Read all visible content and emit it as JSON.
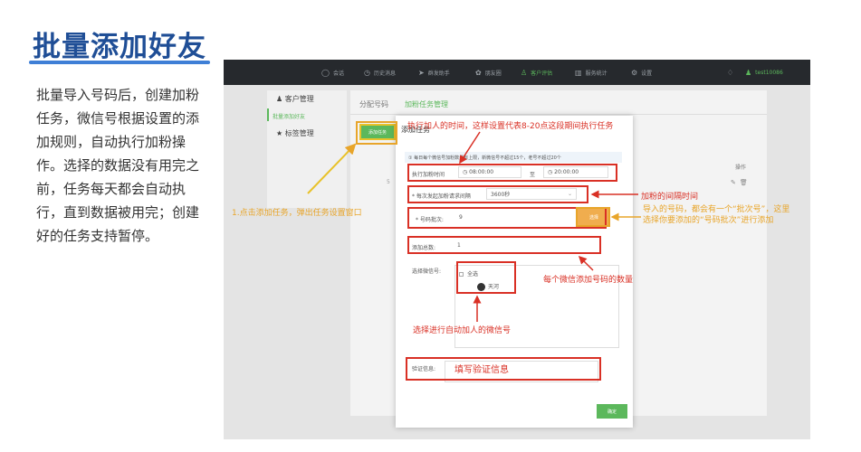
{
  "slide": {
    "title": "批量添加好友",
    "description": "批量导入号码后，创建加粉任务，微信号根据设置的添加规则，自动执行加粉操作。选择的数据没有用完之前，任务每天都会自动执行，直到数据被用完；创建好的任务支持暂停。"
  },
  "app": {
    "topnav": {
      "items": [
        {
          "icon": "chat-icon",
          "label": "会话"
        },
        {
          "icon": "clock-icon",
          "label": "历史消息"
        },
        {
          "icon": "send-icon",
          "label": "群发助手"
        },
        {
          "icon": "moments-icon",
          "label": "朋友圈"
        },
        {
          "icon": "user-icon",
          "label": "客户评估",
          "active": true
        },
        {
          "icon": "bar-chart-icon",
          "label": "服务统计"
        },
        {
          "icon": "gear-icon",
          "label": "设置"
        }
      ],
      "user": "test10086"
    },
    "sidebar": {
      "customer_mgmt": "客户管理",
      "batch_add": "批量添加好友",
      "tag_mgmt": "标签管理"
    },
    "tabs": [
      "分配号码",
      "加粉任务管理"
    ],
    "add_task_button": "添加任务",
    "col_operation": "操作",
    "faint_row_number": "5"
  },
  "modal": {
    "title": "添加任务",
    "notice": "① 每日每个微信号加粉数量有上限，新微信号不超过15个，老号不超过20个",
    "exec_time_label": "执行加粉时间",
    "start_time": "08:00:00",
    "time_sep": "至",
    "end_time": "20:00:00",
    "interval_label": "* 每次发起加粉请求间隔",
    "interval_value": "3600秒",
    "batch_label": "* 号码批次:",
    "batch_value": "9",
    "select_button": "选择",
    "total_label": "添加总数:",
    "total_value": "1",
    "wechat_label": "选择微信号:",
    "select_all": "全选",
    "wechat_name": "天河",
    "verify_label": "验证信息:",
    "verify_placeholder": "填写验证信息",
    "confirm_button": "确定"
  },
  "annotations": {
    "exec_time": "执行加人的时间，这样设置代表8-20点这段期间执行任务",
    "interval": "加粉的间隔时间",
    "batch": "导入的号码，都会有一个“批次号”，这里选择你要添加的“号码批次”进行添加",
    "total": "每个微信添加号码的数量",
    "wechat": "选择进行自动加人的微信号",
    "add_task": "1.点击添加任务，弹出任务设置窗口"
  },
  "colors": {
    "title_blue": "#1f4e96",
    "brand_green": "#5cb85c",
    "annotation_red": "#d93025",
    "annotation_orange": "#e8a52a"
  }
}
